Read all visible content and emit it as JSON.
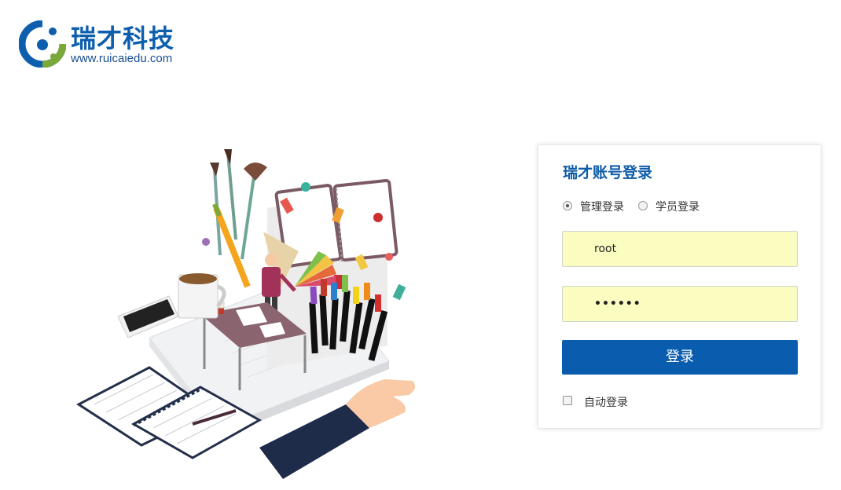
{
  "logo": {
    "brand": "瑞才科技",
    "url": "www.ruicaiedu.com",
    "icon": "ruicai-logo-icon",
    "colors": {
      "blue": "#0d5fae",
      "green": "#7aa83a"
    }
  },
  "illustration": {
    "icon": "design-workspace-illustration"
  },
  "login": {
    "title": "瑞才账号登录",
    "login_types": [
      {
        "label": "管理登录",
        "checked": true
      },
      {
        "label": "学员登录",
        "checked": false
      }
    ],
    "username_value": "root",
    "password_mask": "••••••",
    "submit_label": "登录",
    "remember_label": "自动登录",
    "remember_checked": false,
    "colors": {
      "accent": "#0a5caf",
      "autofill_bg": "#fafcc0"
    }
  }
}
